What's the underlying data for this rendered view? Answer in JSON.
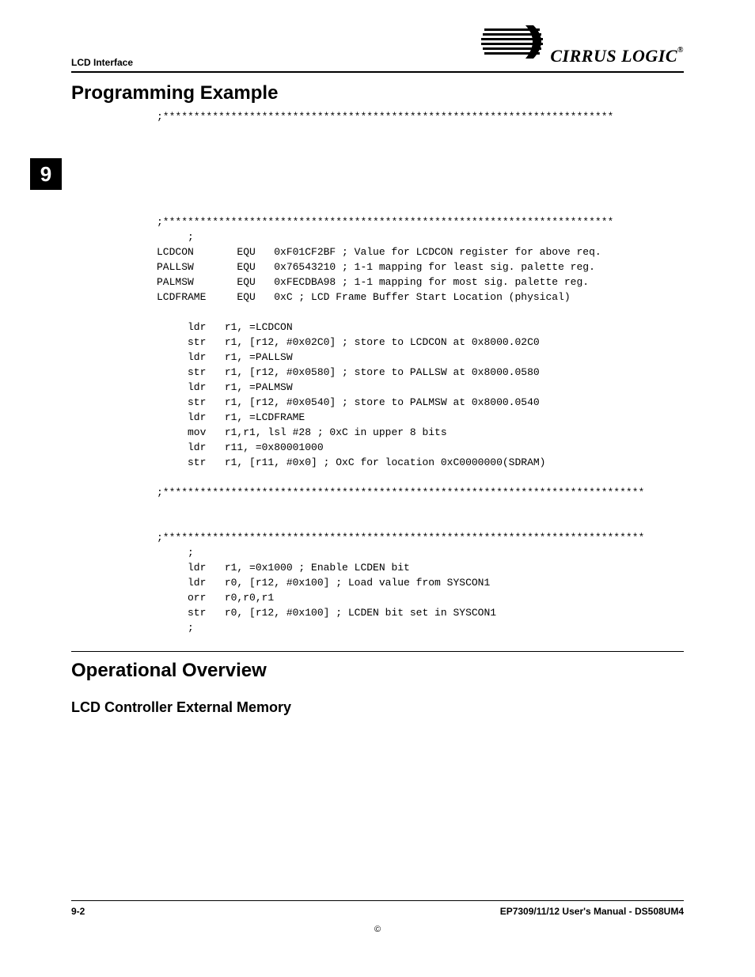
{
  "header": {
    "left": "LCD Interface",
    "logo_text": "CIRRUS LOGIC"
  },
  "chapter_tab": "9",
  "sections": {
    "h1a": "Programming Example",
    "h1b": "Operational Overview",
    "h2a": "LCD Controller External Memory"
  },
  "code": ";*************************************************************************\n\n\n\n\n\n\n;*************************************************************************\n     ;\nLCDCON       EQU   0xF01CF2BF ; Value for LCDCON register for above req.\nPALLSW       EQU   0x76543210 ; 1-1 mapping for least sig. palette reg.\nPALMSW       EQU   0xFECDBA98 ; 1-1 mapping for most sig. palette reg.\nLCDFRAME     EQU   0xC ; LCD Frame Buffer Start Location (physical)\n\n     ldr   r1, =LCDCON\n     str   r1, [r12, #0x02C0] ; store to LCDCON at 0x8000.02C0\n     ldr   r1, =PALLSW\n     str   r1, [r12, #0x0580] ; store to PALLSW at 0x8000.0580\n     ldr   r1, =PALMSW\n     str   r1, [r12, #0x0540] ; store to PALMSW at 0x8000.0540\n     ldr   r1, =LCDFRAME\n     mov   r1,r1, lsl #28 ; 0xC in upper 8 bits\n     ldr   r11, =0x80001000\n     str   r1, [r11, #0x0] ; OxC for location 0xC0000000(SDRAM)\n\n;******************************************************************************\n\n\n;******************************************************************************\n     ;\n     ldr   r1, =0x1000 ; Enable LCDEN bit\n     ldr   r0, [r12, #0x100] ; Load value from SYSCON1\n     orr   r0,r0,r1\n     str   r0, [r12, #0x100] ; LCDEN bit set in SYSCON1\n     ;",
  "footer": {
    "left": "9-2",
    "right": "EP7309/11/12 User's Manual - DS508UM4",
    "copy": "©"
  }
}
